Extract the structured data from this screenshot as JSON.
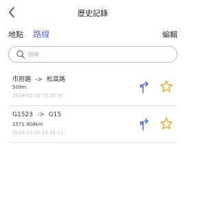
{
  "header": {
    "title": "歷史記錄",
    "back_icon": "chevron-left-icon"
  },
  "tabs": [
    {
      "label": "地點",
      "active": false
    },
    {
      "label": "路線",
      "active": true
    }
  ],
  "edit_label": "編輯",
  "search": {
    "placeholder": "搜尋",
    "value": ""
  },
  "routes": [
    {
      "from": "市府路",
      "arrow": "->",
      "to": "松高路",
      "distance": "509m",
      "timestamp": "2024-03-20 15:05:37"
    },
    {
      "from": "G1523",
      "arrow": "->",
      "to": "G15",
      "distance": "1571.908km",
      "timestamp": "2024-03-20 15:04:11"
    }
  ],
  "colors": {
    "accent": "#5b6fd8",
    "star": "#f0a534"
  }
}
